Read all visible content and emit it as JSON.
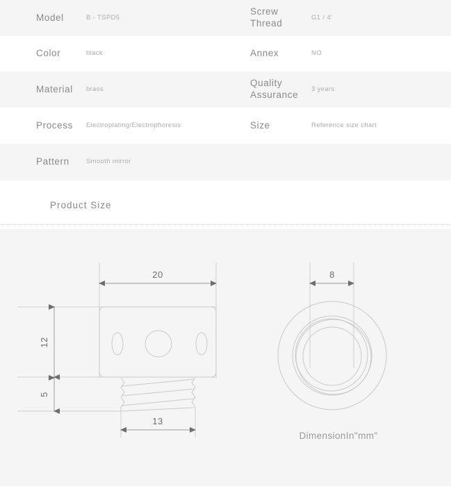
{
  "spec_table": {
    "rows": [
      {
        "left_label": "Model",
        "left_value": "B - TSPD5",
        "right_label": "Screw Thread",
        "right_value": "G1 / 4'"
      },
      {
        "left_label": "Color",
        "left_value": "black",
        "right_label": "Annex",
        "right_value": "NO"
      },
      {
        "left_label": "Material",
        "left_value": "brass",
        "right_label": "Quality Assurance",
        "right_value": "3 years"
      },
      {
        "left_label": "Process",
        "left_value": "Electroplating/Electrophoresis",
        "right_label": "Size",
        "right_value": "Reference size chart"
      },
      {
        "left_label": "Pattern",
        "left_value": "Smooth mirror",
        "right_label": "",
        "right_value": ""
      }
    ]
  },
  "section": {
    "title": "Product Size"
  },
  "drawing": {
    "caption": "DimensionIn\"mm\"",
    "dimensions": {
      "width_top": "20",
      "height_body": "12",
      "height_thread": "5",
      "width_thread": "13",
      "bore_diameter": "8"
    }
  },
  "colors": {
    "row_shaded": "#f5f5f6",
    "row_plain": "#ffffff",
    "panel_bg": "#f5f5f6",
    "label_text": "#8a8a8a",
    "value_text": "#adadad",
    "line": "#c9c9c9",
    "dim": "#6e6e6e"
  }
}
